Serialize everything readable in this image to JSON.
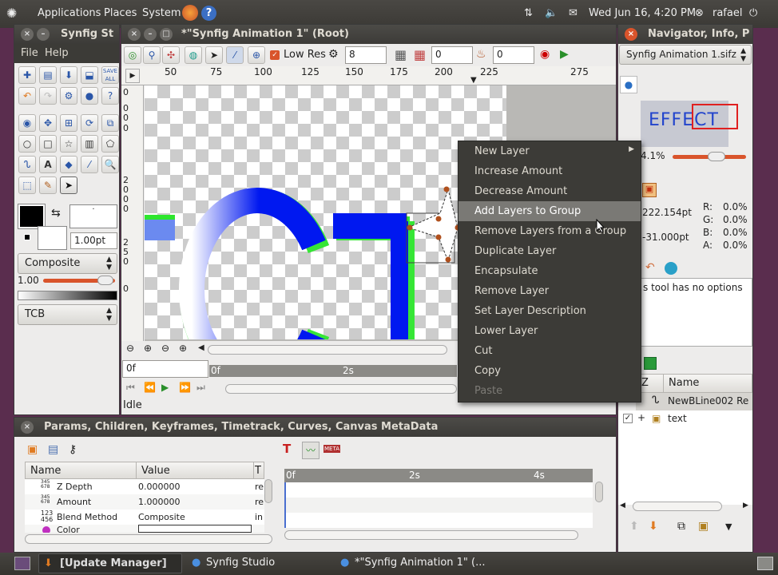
{
  "topbar": {
    "applications": "Applications",
    "places": "Places",
    "system": "System",
    "datetime": "Wed Jun 16, 4:20 PM",
    "user": "rafael"
  },
  "toolbox": {
    "title": "Synfig St",
    "menu": [
      "File",
      "Help"
    ],
    "brush_size": "1.00pt",
    "blend": "Composite",
    "opacity": "1.00",
    "interp": "TCB"
  },
  "canvas_window": {
    "title": "*\"Synfig Animation 1\" (Root)",
    "lowres_label": "Low Res",
    "lowres_value": "8",
    "field2": "0",
    "field3": "0",
    "ruler_h": [
      "50",
      "75",
      "100",
      "125",
      "150",
      "175",
      "200",
      "225",
      "275"
    ],
    "ruler_v": [
      "0",
      "0",
      "0",
      "0",
      "2",
      "0",
      "0",
      "0",
      "2",
      "5",
      "0",
      "0"
    ],
    "time_field": "0f",
    "timeline_start": "0f",
    "timeline_2s": "2s",
    "status": "Idle",
    "canvas_text": "EFFECT"
  },
  "context_menu": {
    "items": [
      {
        "label": "New Layer",
        "submenu": true
      },
      {
        "label": "Increase Amount"
      },
      {
        "label": "Decrease Amount"
      },
      {
        "label": "Add Layers to Group"
      },
      {
        "label": "Remove Layers from a Group"
      },
      {
        "label": "Duplicate Layer"
      },
      {
        "label": "Encapsulate"
      },
      {
        "label": "Remove Layer"
      },
      {
        "label": "Set Layer Description"
      },
      {
        "label": "Lower Layer"
      },
      {
        "label": "Cut"
      },
      {
        "label": "Copy"
      },
      {
        "label": "Paste",
        "disabled": true
      }
    ]
  },
  "navigator": {
    "title": "Navigator, Info, P",
    "file_combo": "Synfig Animation 1.sifz",
    "preview_text": "EFFECT",
    "zoom": "4.1%",
    "x_value": "222.154pt",
    "y_value": "-31.000pt",
    "r": "R:",
    "r_val": "0.0%",
    "g": "G:",
    "g_val": "0.0%",
    "b": "B:",
    "b_val": "0.0%",
    "a": "A:",
    "a_val": "0.0%",
    "tool_options": "s tool has no options"
  },
  "layers": {
    "col_z": "Z",
    "col_name": "Name",
    "rows": [
      {
        "name": "NewBLine002 Re"
      },
      {
        "name": "text"
      }
    ]
  },
  "params": {
    "title": "Params, Children, Keyframes, Timetrack, Curves, Canvas MetaData",
    "col_name": "Name",
    "col_value": "Value",
    "col_t": "T",
    "rows": [
      {
        "name": "Z Depth",
        "value": "0.000000",
        "t": "re"
      },
      {
        "name": "Amount",
        "value": "1.000000",
        "t": "re"
      },
      {
        "name": "Blend Method",
        "value": "Composite",
        "t": "in"
      },
      {
        "name": "Color",
        "value": "",
        "t": ""
      }
    ],
    "timetrack_0f": "0f",
    "timetrack_2s": "2s",
    "timetrack_4s": "4s"
  },
  "taskbar": {
    "items": [
      "[Update Manager]",
      "Synfig Studio",
      "*\"Synfig Animation 1\" (..."
    ]
  }
}
